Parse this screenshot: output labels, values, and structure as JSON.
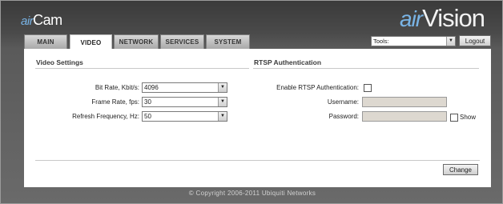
{
  "brand": {
    "left_air": "air",
    "left_name": "Cam",
    "right_air": "air",
    "right_name": "Vision"
  },
  "tabs": [
    {
      "label": "MAIN",
      "active": false
    },
    {
      "label": "VIDEO",
      "active": true
    },
    {
      "label": "NETWORK",
      "active": false
    },
    {
      "label": "SERVICES",
      "active": false
    },
    {
      "label": "SYSTEM",
      "active": false
    }
  ],
  "toolbar": {
    "tools_value": "Tools:",
    "logout_label": "Logout"
  },
  "video_settings": {
    "title": "Video Settings",
    "bit_rate_label": "Bit Rate, Kbit/s:",
    "bit_rate_value": "4096",
    "frame_rate_label": "Frame Rate, fps:",
    "frame_rate_value": "30",
    "refresh_label": "Refresh Frequency, Hz:",
    "refresh_value": "50"
  },
  "rtsp": {
    "title": "RTSP Authentication",
    "enable_label": "Enable RTSP Authentication:",
    "enabled": false,
    "username_label": "Username:",
    "username_value": "",
    "password_label": "Password:",
    "password_value": "",
    "show_label": "Show",
    "show_checked": false
  },
  "actions": {
    "change_label": "Change"
  },
  "footer": {
    "copyright": "© Copyright 2006-2011 Ubiquiti Networks"
  },
  "colors": {
    "brand_accent": "#79b4e6",
    "input_disabled_bg": "#ddd8d0"
  }
}
